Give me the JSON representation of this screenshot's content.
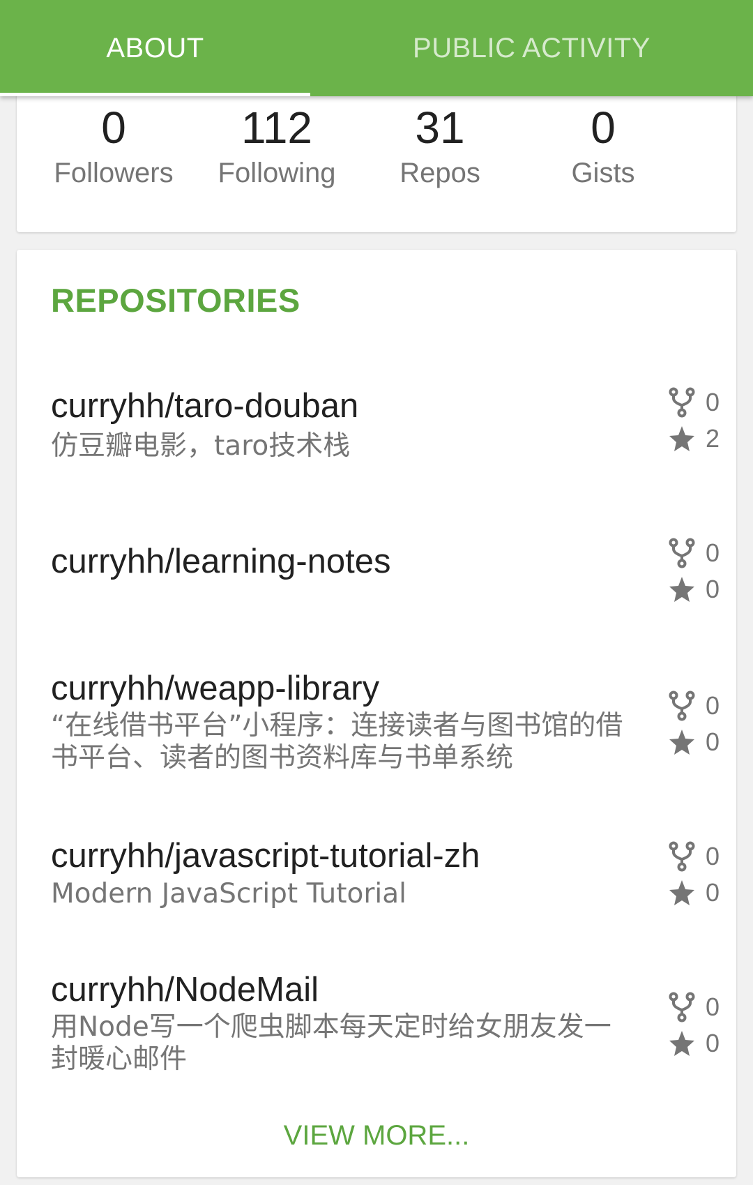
{
  "tabs": {
    "about": "ABOUT",
    "public_activity": "PUBLIC ACTIVITY"
  },
  "stats": {
    "followers": {
      "value": "0",
      "label": "Followers"
    },
    "following": {
      "value": "112",
      "label": "Following"
    },
    "repos": {
      "value": "31",
      "label": "Repos"
    },
    "gists": {
      "value": "0",
      "label": "Gists"
    }
  },
  "repositories": {
    "title": "REPOSITORIES",
    "items": [
      {
        "name": "curryhh/taro-douban",
        "description": "仿豆瓣电影，taro技术栈",
        "forks": "0",
        "stars": "2"
      },
      {
        "name": "curryhh/learning-notes",
        "description": "",
        "forks": "0",
        "stars": "0"
      },
      {
        "name": "curryhh/weapp-library",
        "description": "“在线借书平台”小程序：连接读者与图书馆的借书平台、读者的图书资料库与书单系统",
        "forks": "0",
        "stars": "0"
      },
      {
        "name": "curryhh/javascript-tutorial-zh",
        "description": "Modern JavaScript Tutorial",
        "forks": "0",
        "stars": "0"
      },
      {
        "name": "curryhh/NodeMail",
        "description": "用Node写一个爬虫脚本每天定时给女朋友发一封暖心邮件",
        "forks": "0",
        "stars": "0"
      }
    ],
    "view_more": "VIEW MORE..."
  },
  "colors": {
    "brand_green": "#6bb34a",
    "accent_green": "#5ca63f",
    "icon_gray": "#757575"
  }
}
